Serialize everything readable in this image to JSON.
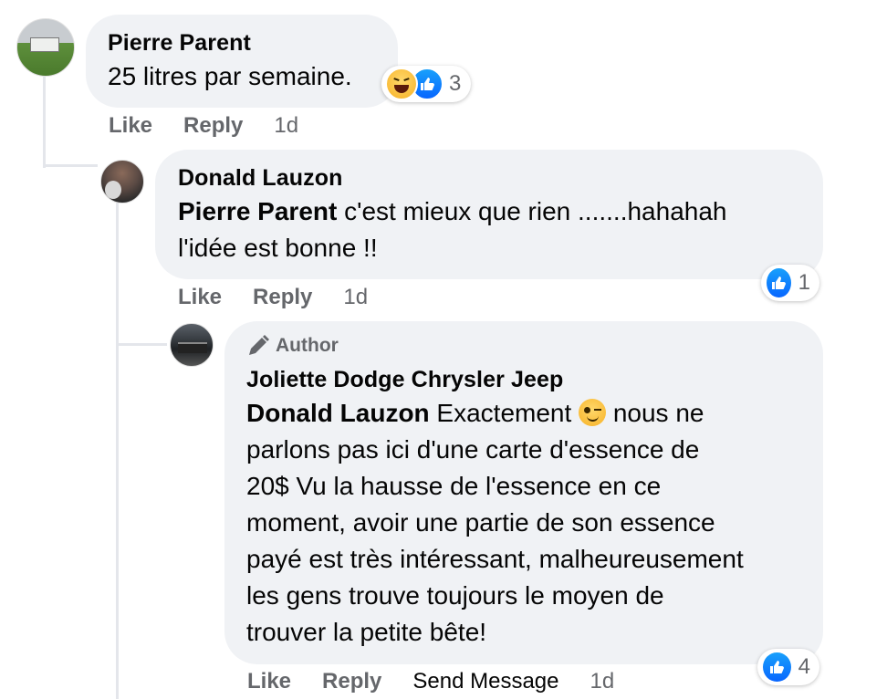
{
  "comments": [
    {
      "author": "Pierre Parent",
      "text": "25 litres par semaine.",
      "actions": {
        "like": "Like",
        "reply": "Reply",
        "time": "1d"
      },
      "reactions": {
        "types": [
          "haha",
          "like"
        ],
        "count": "3"
      }
    },
    {
      "author": "Donald Lauzon",
      "mention": "Pierre Parent",
      "text_line1": " c'est mieux que rien .......hahahah",
      "text_line2": "l'idée est bonne !!",
      "actions": {
        "like": "Like",
        "reply": "Reply",
        "time": "1d"
      },
      "reactions": {
        "types": [
          "like"
        ],
        "count": "1"
      }
    },
    {
      "badge": "Author",
      "author": "Joliette Dodge Chrysler Jeep",
      "mention": "Donald Lauzon",
      "line1_a": " Exactement ",
      "line1_b": " nous ne",
      "line2": "parlons pas ici d'une carte d'essence de",
      "line3": "20$ Vu la hausse de l'essence en ce",
      "line4": "moment, avoir une partie de son essence",
      "line5": "payé est très intéressant, malheureusement",
      "line6": "les gens trouve toujours le moyen de",
      "line7": "trouver la petite bête!",
      "actions": {
        "like": "Like",
        "reply": "Reply",
        "send": "Send Message",
        "time": "1d"
      },
      "reactions": {
        "types": [
          "like"
        ],
        "count": "4"
      }
    }
  ],
  "icons": {
    "like": "thumbs-up-icon",
    "haha": "laughing-face-icon",
    "wink": "winking-face-icon",
    "author": "pencil-icon"
  },
  "colors": {
    "bubble": "#f0f2f5",
    "like_blue": "#0866ff",
    "meta_gray": "#65676b"
  }
}
